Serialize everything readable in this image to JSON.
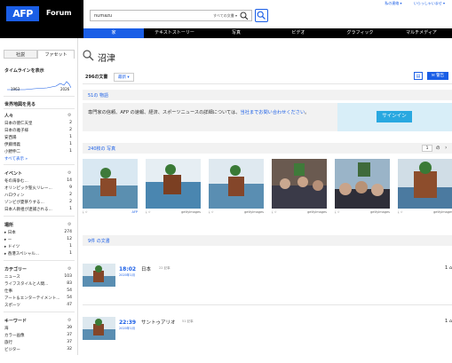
{
  "header": {
    "logo": "AFP",
    "forum": "Forum",
    "search_query": "numazu",
    "search_scope": "すべての文書 ▾",
    "user_link1": "私の連絡 ▾",
    "user_link2": "いらっしゃいませ ▾"
  },
  "nav": [
    "家",
    "テキストストーリー",
    "写真",
    "ビデオ",
    "グラフィック",
    "マルチメディア"
  ],
  "sidebar": {
    "tab_company": "社説",
    "tab_facet": "ファセット",
    "timeline_title": "タイムラインを表示",
    "timeline_start": "1963",
    "timeline_end": "2026",
    "world_map": "世界地図を見る",
    "people": {
      "title": "人々",
      "items": [
        {
          "name": "日本の徳仁天皇",
          "count": "2"
        },
        {
          "name": "日本の雅子様",
          "count": "2"
        },
        {
          "name": "安西陽",
          "count": "1"
        },
        {
          "name": "伊藤博義",
          "count": "1"
        },
        {
          "name": "小野伸二",
          "count": "1"
        }
      ],
      "more": "すべて表示 »"
    },
    "events": {
      "title": "イベント",
      "items": [
        {
          "name": "冬の海争む...",
          "count": "14"
        },
        {
          "name": "オリンピック聖火リレー...",
          "count": "9"
        },
        {
          "name": "ハロウィン",
          "count": "2"
        },
        {
          "name": "ゾンビが夏祭りする...",
          "count": "2"
        },
        {
          "name": "日本人教祖が逮捕される...",
          "count": "1"
        }
      ]
    },
    "places": {
      "title": "場所",
      "items": [
        {
          "name": "▸ 日本",
          "count": "274"
        },
        {
          "name": "▸ ー",
          "count": "12"
        },
        {
          "name": "▸ ドイツ",
          "count": "1"
        },
        {
          "name": "▸ 香港スペシャル...",
          "count": "1"
        }
      ]
    },
    "categories": {
      "title": "カテゴリー",
      "items": [
        {
          "name": "ニュース",
          "count": "103"
        },
        {
          "name": "ライフスタイルと人間...",
          "count": "83"
        },
        {
          "name": "仕事",
          "count": "54"
        },
        {
          "name": "アート＆エンターテイメント...",
          "count": "54"
        },
        {
          "name": "スポーツ",
          "count": "47"
        }
      ]
    },
    "keywords": {
      "title": "キーワード",
      "items": [
        {
          "name": "海",
          "count": "39"
        },
        {
          "name": "カラー画像",
          "count": "37"
        },
        {
          "name": "旅行",
          "count": "37"
        },
        {
          "name": "ビジター",
          "count": "32"
        }
      ]
    }
  },
  "main": {
    "title": "沼津",
    "doc_count": "296の文書",
    "sort": "最新 ▾",
    "alert_label": "警告",
    "stories_tab": "51の 物語",
    "promo_text": "専門家の信頼、AFP の速報、経済、スポーツニュースの詳細については、",
    "promo_link": "当社までお問い合わせください",
    "promo_end": "。",
    "signin": "サインイン",
    "photos_label": "240枚の 写真",
    "page_num": "1",
    "page_of": "の",
    "photo_credits": [
      "AFP",
      "gettyimages",
      "gettyimages",
      "gettyimages",
      "gettyimages",
      "gettyimages"
    ],
    "docs_label": "9件 の文書",
    "stories": [
      {
        "time": "18:02",
        "date": "2020年1月",
        "title": "日本",
        "sub": "22 記事",
        "count": "1 ⌂"
      },
      {
        "time": "22:39",
        "date": "2020年1月",
        "title": "サントゥアリオ",
        "sub": "51 記事",
        "count": "1 ⌂"
      }
    ]
  }
}
